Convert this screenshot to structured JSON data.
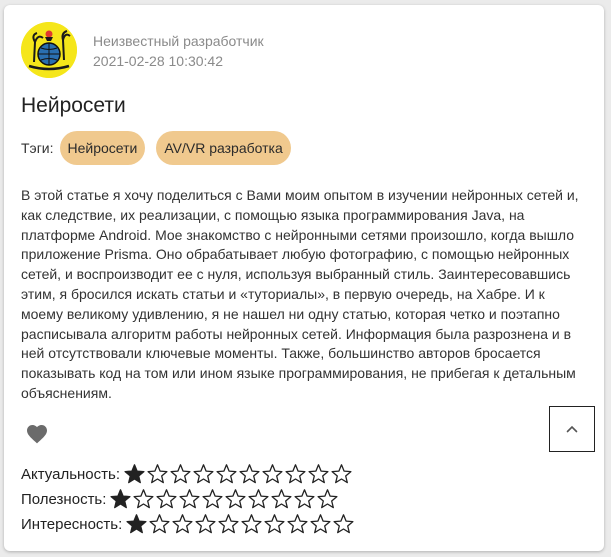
{
  "post": {
    "author": "Неизвестный разработчик",
    "date": "2021-02-28 10:30:42",
    "title": "Нейросети",
    "tags_label": "Тэги:",
    "tags": [
      "Нейросети",
      "AV/VR разработка"
    ],
    "body": "В этой статье я хочу поделиться с Вами моим опытом в изучении нейронных сетей и, как следствие, их реализации, с помощью языка программирования Java, на платформе Android. Мое знакомство с нейронными сетями произошло, когда вышло приложение Prisma. Оно обрабатывает любую фотографию, с помощью нейронных сетей, и воспроизводит ее с нуля, используя выбранный стиль. Заинтересовавшись этим, я бросился искать статьи и «туториалы», в первую очередь, на Хабре. И к моему великому удивлению, я не нашел ни одну статью, которая четко и поэтапно расписывала алгоритм работы нейронных сетей. Информация была разрознена и в ней отсутствовали ключевые моменты. Также, большинство авторов бросается показывать код на том или ином языке программирования, не прибегая к детальным объяснениям."
  },
  "ratings": [
    {
      "label": "Актуальность:",
      "value": 1,
      "max": 10
    },
    {
      "label": "Полезность:",
      "value": 1,
      "max": 10
    },
    {
      "label": "Интересность:",
      "value": 1,
      "max": 10
    }
  ],
  "icons": {
    "avatar": "globe-palm-logo-icon",
    "like": "heart-icon",
    "scroll_top": "chevron-up-icon",
    "star_filled": "star-filled-icon",
    "star_empty": "star-outline-icon"
  },
  "colors": {
    "avatar_bg": "#f5e61a",
    "tag_bg": "#f0c98e",
    "meta_text": "#8a8a8a",
    "heart": "#6b6b6b"
  }
}
